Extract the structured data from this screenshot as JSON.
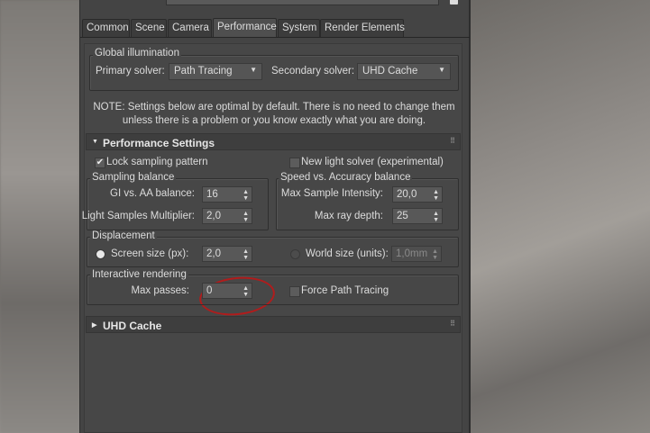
{
  "tabs": [
    "Common",
    "Scene",
    "Camera",
    "Performance",
    "System",
    "Render Elements"
  ],
  "active_tab": "Performance",
  "global_illumination": {
    "title": "Global illumination",
    "primary_label": "Primary solver:",
    "primary_value": "Path Tracing",
    "secondary_label": "Secondary solver:",
    "secondary_value": "UHD Cache"
  },
  "note": [
    "NOTE: Settings below are optimal by default. There is no need to change them",
    "unless there is a problem or you know exactly what you are doing."
  ],
  "performance": {
    "title": "Performance Settings",
    "lock_sampling": {
      "label": "Lock sampling pattern",
      "checked": true
    },
    "new_light_solver": {
      "label": "New light solver (experimental)",
      "checked": false
    },
    "sampling_balance": {
      "title": "Sampling balance",
      "gi_aa_label": "GI vs. AA balance:",
      "gi_aa_value": "16",
      "light_mult_label": "Light Samples Multiplier:",
      "light_mult_value": "2,0"
    },
    "speed_accuracy": {
      "title": "Speed vs. Accuracy balance",
      "max_intensity_label": "Max Sample Intensity:",
      "max_intensity_value": "20,0",
      "max_depth_label": "Max ray depth:",
      "max_depth_value": "25"
    },
    "displacement": {
      "title": "Displacement",
      "screen_label": "Screen size (px):",
      "screen_value": "2,0",
      "world_label": "World size (units):",
      "world_value": "1,0mm"
    },
    "interactive": {
      "title": "Interactive rendering",
      "max_passes_label": "Max passes:",
      "max_passes_value": "0",
      "force_pt_label": "Force Path Tracing",
      "force_pt_checked": false
    }
  },
  "uhd_cache": {
    "title": "UHD Cache"
  },
  "icons": {
    "check": "✔",
    "dropdown": "▼",
    "spinner": "▲▼",
    "expanded": "▼",
    "collapsed": "▶",
    "grip": "⠿"
  }
}
